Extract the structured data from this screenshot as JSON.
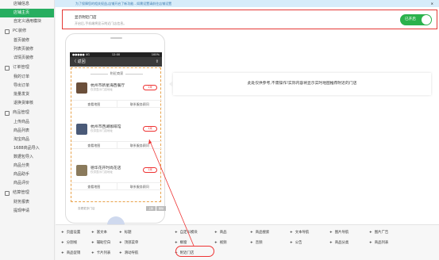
{
  "notice": {
    "text": "为了保障您的相关权益,店铺开启了新功能...如需设置请前往店铺设置",
    "close_label": "×"
  },
  "sidebar": {
    "items": [
      {
        "type": "item",
        "label": "店铺信息",
        "active": false
      },
      {
        "type": "item",
        "label": "店铺主页",
        "active": true
      },
      {
        "type": "item",
        "label": "自定义通用模块",
        "active": false
      },
      {
        "type": "group",
        "label": "PC装修"
      },
      {
        "type": "item",
        "label": "首页装修",
        "active": false
      },
      {
        "type": "item",
        "label": "列表页装修",
        "active": false
      },
      {
        "type": "item",
        "label": "详情页装修",
        "active": false
      },
      {
        "type": "group",
        "label": "订单管理"
      },
      {
        "type": "item",
        "label": "我的订单",
        "active": false
      },
      {
        "type": "item",
        "label": "导出订单",
        "active": false
      },
      {
        "type": "item",
        "label": "批量发货",
        "active": false
      },
      {
        "type": "item",
        "label": "退换货审核",
        "active": false
      },
      {
        "type": "group",
        "label": "商品管理"
      },
      {
        "type": "item",
        "label": "上传商品",
        "active": false
      },
      {
        "type": "item",
        "label": "商品列表",
        "active": false
      },
      {
        "type": "item",
        "label": "淘宝商品",
        "active": false
      },
      {
        "type": "item",
        "label": "1688商品导入",
        "active": false
      },
      {
        "type": "item",
        "label": "数据包导入",
        "active": false
      },
      {
        "type": "item",
        "label": "商品分类",
        "active": false
      },
      {
        "type": "item",
        "label": "商品助手",
        "active": false
      },
      {
        "type": "item",
        "label": "商品评价",
        "active": false
      },
      {
        "type": "group",
        "label": "结算管理"
      },
      {
        "type": "item",
        "label": "财务报表",
        "active": false
      },
      {
        "type": "item",
        "label": "提现申请",
        "active": false
      }
    ]
  },
  "toggle": {
    "title": "显示附近门店",
    "desc": "开启后,手机端将显示附近门店信息。",
    "switch_label": "已开启"
  },
  "phone": {
    "status_left": "●●●●● 4G",
    "status_time": "12:00",
    "status_right": "100%",
    "nav_back": "〈 返回",
    "nav_share": "⇪",
    "nearby_title": "附近商家",
    "stores": [
      {
        "name": "杭州市新星海西餐厅",
        "addr": "仅供显示门店地址",
        "dist": "1米",
        "btn_left": "查看地图",
        "btn_right": "联系服务顾问",
        "color": "#6b4f3a"
      },
      {
        "name": "杭州市西湖咖啡馆",
        "addr": "仅供显示门店地址",
        "dist": "1米",
        "btn_left": "查看地图",
        "btn_right": "联系服务顾问",
        "color": "#4a5a78"
      },
      {
        "name": "德华花开时尚花店",
        "addr": "仅供显示门店地址",
        "dist": "1米",
        "btn_left": "查看地图",
        "btn_right": "联系服务顾问",
        "color": "#8a7a5c"
      }
    ],
    "more_text": "查看更多门店",
    "more_btn1": "上移",
    "more_btn2": "删除"
  },
  "tip": {
    "text": "此处仅供参考,不需操作!实际内容将显示实时地图推荐附近的门店"
  },
  "toolbar": {
    "items": [
      "页面设置",
      "富文本",
      "标题",
      "自定义模块",
      "商品",
      "商品搜索",
      "文本导航",
      "图片导航",
      "图片广告",
      "分割线",
      "辅助空白",
      "顶部菜单",
      "橱窗",
      "视频",
      "音频",
      "公告",
      "商品分类",
      "商品列表",
      "商品促销",
      "卡片列表",
      "滑动导航",
      "附近门店"
    ]
  }
}
